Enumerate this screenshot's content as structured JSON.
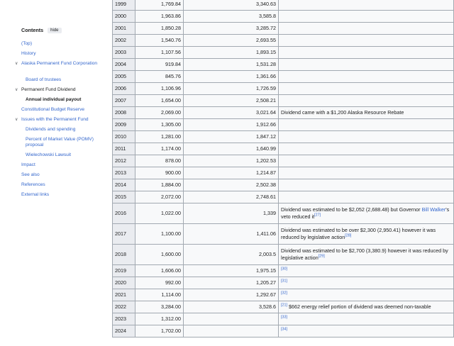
{
  "toc": {
    "title": "Contents",
    "hide_label": "hide",
    "items": [
      {
        "label": "(Top)"
      },
      {
        "label": "History"
      },
      {
        "label": "Alaska Permanent Fund Corporation"
      },
      {
        "label": "Board of trustees"
      },
      {
        "label": "Permanent Fund Dividend"
      },
      {
        "label": "Annual individual payout"
      },
      {
        "label": "Constitutional Budget Reserve"
      },
      {
        "label": "Issues with the Permanent Fund"
      },
      {
        "label": "Dividends and spending"
      },
      {
        "label": "Percent of Market Value (POMV) proposal"
      },
      {
        "label": "Wielechowski Lawsuit"
      },
      {
        "label": "Impact"
      },
      {
        "label": "See also"
      },
      {
        "label": "References"
      },
      {
        "label": "External links"
      }
    ]
  },
  "table": {
    "rows": [
      {
        "year": "1999",
        "dividend": "1,769.84",
        "amount": "3,340.63"
      },
      {
        "year": "2000",
        "dividend": "1,963.86",
        "amount": "3,585.8"
      },
      {
        "year": "2001",
        "dividend": "1,850.28",
        "amount": "3,285.72"
      },
      {
        "year": "2002",
        "dividend": "1,540.76",
        "amount": "2,693.55"
      },
      {
        "year": "2003",
        "dividend": "1,107.56",
        "amount": "1,893.15"
      },
      {
        "year": "2004",
        "dividend": "919.84",
        "amount": "1,531.28"
      },
      {
        "year": "2005",
        "dividend": "845.76",
        "amount": "1,361.66"
      },
      {
        "year": "2006",
        "dividend": "1,106.96",
        "amount": "1,726.59"
      },
      {
        "year": "2007",
        "dividend": "1,654.00",
        "amount": "2,508.21"
      },
      {
        "year": "2008",
        "dividend": "2,069.00",
        "amount": "3,021.64",
        "note": "Dividend came with a $1,200 Alaska Resource Rebate"
      },
      {
        "year": "2009",
        "dividend": "1,305.00",
        "amount": "1,912.66"
      },
      {
        "year": "2010",
        "dividend": "1,281.00",
        "amount": "1,847.12"
      },
      {
        "year": "2011",
        "dividend": "1,174.00",
        "amount": "1,640.99"
      },
      {
        "year": "2012",
        "dividend": "878.00",
        "amount": "1,202.53"
      },
      {
        "year": "2013",
        "dividend": "900.00",
        "amount": "1,214.87"
      },
      {
        "year": "2014",
        "dividend": "1,884.00",
        "amount": "2,502.38"
      },
      {
        "year": "2015",
        "dividend": "2,072.00",
        "amount": "2,748.61"
      },
      {
        "year": "2016",
        "dividend": "1,022.00",
        "amount": "1,339",
        "note_a": "Dividend was estimated to be $2,052 (2,688.48) but Governor ",
        "note_link": "Bill Walker",
        "note_b": "'s veto reduced it",
        "ref": "[27]"
      },
      {
        "year": "2017",
        "dividend": "1,100.00",
        "amount": "1,411.06",
        "note": "Dividend was estimated to be over $2,300 (2,950.41) however it was reduced by legislative action",
        "ref": "[28]"
      },
      {
        "year": "2018",
        "dividend": "1,600.00",
        "amount": "2,003.5",
        "note": "Dividend was estimated to be $2,700 (3,380.9) however it was reduced by legislative action",
        "ref": "[29]"
      },
      {
        "year": "2019",
        "dividend": "1,606.00",
        "amount": "1,975.15",
        "ref": "[30]"
      },
      {
        "year": "2020",
        "dividend": "992.00",
        "amount": "1,205.27",
        "ref": "[31]"
      },
      {
        "year": "2021",
        "dividend": "1,114.00",
        "amount": "1,292.67",
        "ref": "[32]"
      },
      {
        "year": "2022",
        "dividend": "3,284.00",
        "amount": "3,528.6",
        "ref": "[21]",
        "note": " $662 energy relief portion of dividend was deemed non-taxable"
      },
      {
        "year": "2023",
        "dividend": "1,312.00",
        "amount": "",
        "ref": "[33]"
      },
      {
        "year": "2024",
        "dividend": "1,702.00",
        "amount": "",
        "ref": "[34]"
      }
    ]
  }
}
